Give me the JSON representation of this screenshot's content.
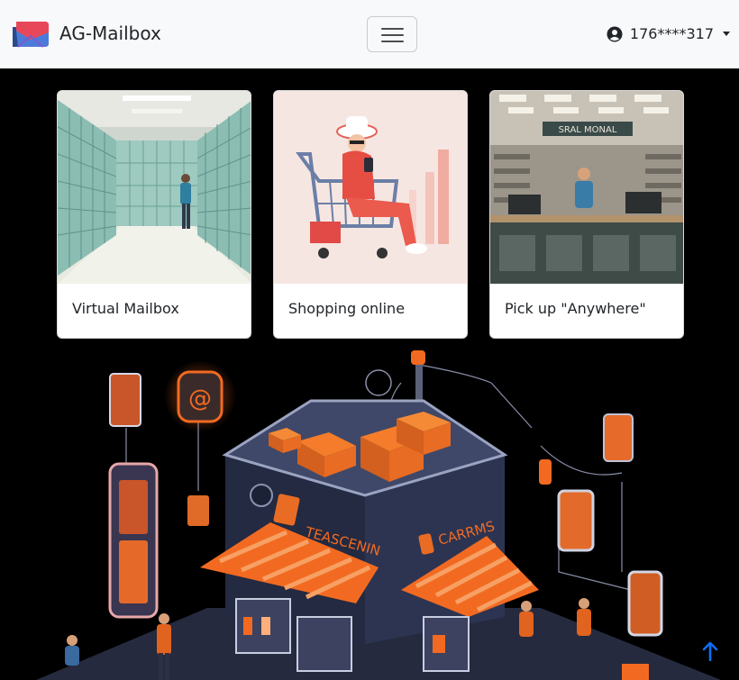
{
  "navbar": {
    "brand_name": "AG-Mailbox",
    "menu_icon": "hamburger-icon",
    "user_label": "176****317",
    "user_icon": "user-circle-icon"
  },
  "cards": [
    {
      "title": "Virtual Mailbox"
    },
    {
      "title": "Shopping online"
    },
    {
      "title": "Pick up \"Anywhere\""
    }
  ],
  "store_illustration": {
    "sign_left": "TEASCENIN",
    "sign_right": "CARRMS"
  },
  "counter_sign": "SRAL MONAL",
  "colors": {
    "navbar_bg": "#f8f9fa",
    "page_bg": "#000000",
    "accent_orange": "#f26a21",
    "back_to_top": "#0d6efd"
  },
  "back_to_top_icon": "arrow-up-icon"
}
